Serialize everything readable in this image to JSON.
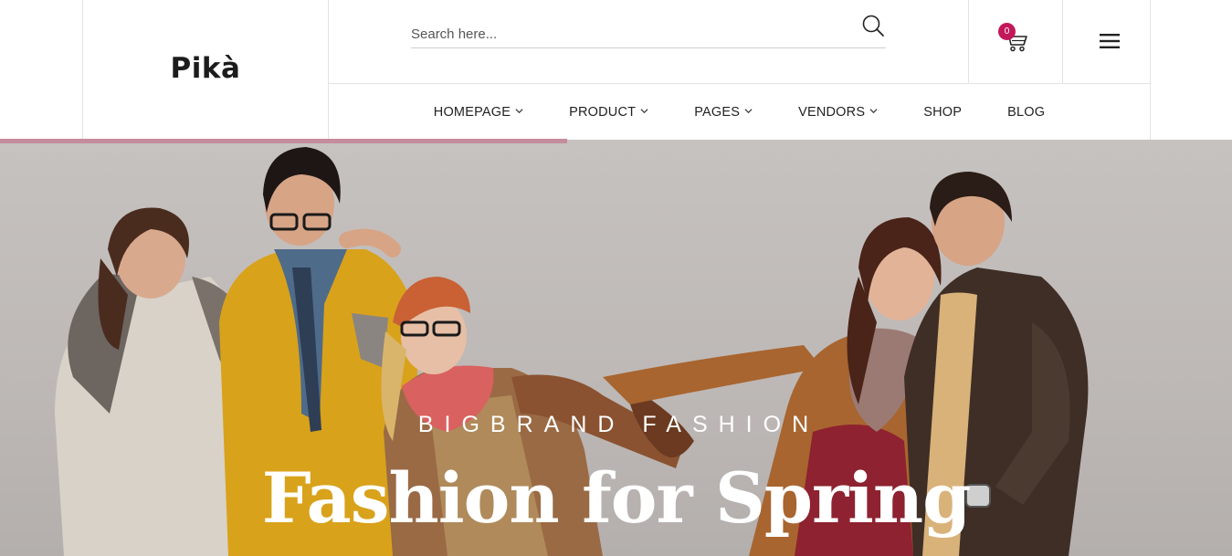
{
  "brand": {
    "logo_text": "Pikà"
  },
  "search": {
    "placeholder": "Search here..."
  },
  "cart": {
    "count": "0"
  },
  "nav": {
    "items": [
      {
        "label": "HOMEPAGE",
        "has_dropdown": true
      },
      {
        "label": "PRODUCT",
        "has_dropdown": true
      },
      {
        "label": "PAGES",
        "has_dropdown": true
      },
      {
        "label": "VENDORS",
        "has_dropdown": true
      },
      {
        "label": "SHOP",
        "has_dropdown": false
      },
      {
        "label": "BLOG",
        "has_dropdown": false
      }
    ]
  },
  "slider": {
    "progress_percent": 46
  },
  "hero": {
    "subtitle": "BIGBRAND FASHION",
    "title": "Fashion for Spring"
  },
  "icons": {
    "search": "search-icon",
    "cart": "cart-icon",
    "menu": "hamburger-menu-icon",
    "dropdown": "chevron-down-icon"
  },
  "colors": {
    "accent": "#c2185b",
    "progress": "#c48c9c",
    "hero_bg": "#c3bfbd",
    "text": "#222222"
  }
}
